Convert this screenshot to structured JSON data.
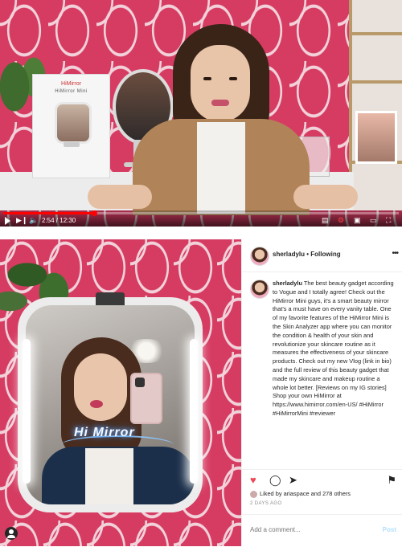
{
  "video": {
    "product_box": {
      "brand": "HiMirror",
      "model": "HiMirror Mini"
    },
    "time": "2:54 / 12:30",
    "progress": 0.23,
    "icons": [
      "play-icon",
      "next-icon",
      "volume-icon",
      "subtitles-icon",
      "settings-icon",
      "miniplayer-icon",
      "fullscreen-icon"
    ]
  },
  "post": {
    "photo_overlay_text": "Hi Mirror",
    "header": {
      "username": "sherladylu",
      "separator": " • ",
      "follow_state": "Following"
    },
    "caption": {
      "username": "sherladylu",
      "text": " The best beauty gadget according to Vogue and I totally agree! Check out the HiMirror Mini guys, it's a smart beauty mirror that's a must have on every vanity table. One of my favorite features of the HiMirror Mini is the Skin Analyzer app where you can monitor the condition & health of your skin and revolutionize your skincare routine as it measures the effectiveness of your skincare products. Check out my new Vlog (link in bio) and the full review of this beauty gadget that made my skincare and makeup routine a whole lot better. [Reviews on my IG stories] Shop your own HiMirror at https://www.himirror.com/en-US/ #HiMirror #HiMirrorMini #reviewer"
    },
    "likes_text": "Liked by ariaspace and 278 others",
    "date": "2 DAYS AGO",
    "comment_placeholder": "Add a comment...",
    "post_button": "Post"
  },
  "colors": {
    "like": "#ed4956",
    "progress": "#ff0000",
    "post_button": "#b2dffc"
  }
}
